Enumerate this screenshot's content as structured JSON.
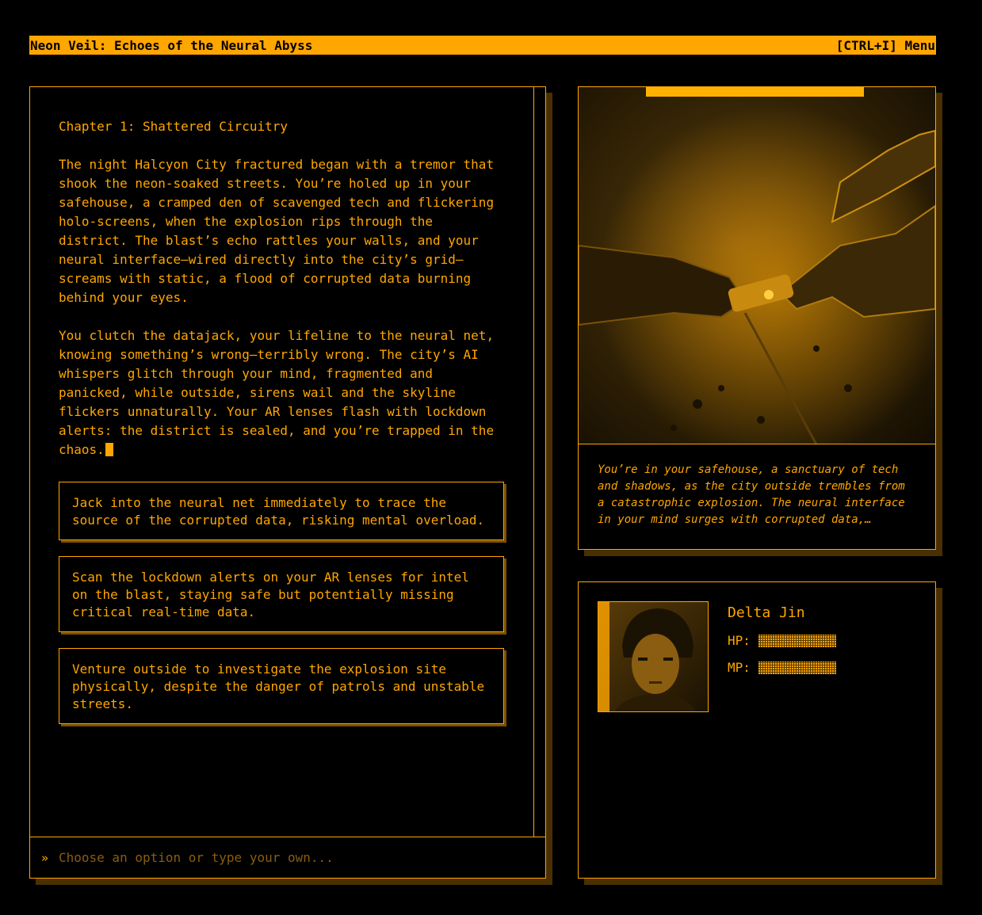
{
  "header": {
    "title": "Neon Veil: Echoes of the Neural Abyss",
    "menu_hint": "[CTRL+I] Menu"
  },
  "story": {
    "chapter": "Chapter 1: Shattered Circuitry",
    "paragraphs": [
      "The night Halcyon City fractured began with a tremor that\nshook the neon-soaked streets. You’re holed up in your\nsafehouse, a cramped den of scavenged tech and flickering\nholo-screens, when the explosion rips through the\ndistrict. The blast’s echo rattles your walls, and your\nneural interface—wired directly into the city’s grid—\nscreams with static, a flood of corrupted data burning\nbehind your eyes.",
      "You clutch the datajack, your lifeline to the neural net,\nknowing something’s wrong—terribly wrong. The city’s AI\nwhispers glitch through your mind, fragmented and\npanicked, while outside, sirens wail and the skyline\nflickers unnaturally. Your AR lenses flash with lockdown\nalerts: the district is sealed, and you’re trapped in the\nchaos."
    ],
    "choices": [
      "Jack into the neural net immediately to trace the source of the corrupted data, risking mental overload.",
      "Scan the lockdown alerts on your AR lenses for intel on the blast, staying safe but potentially missing critical real-time data.",
      "Venture outside to investigate the explosion site physically, despite the danger of patrols and unstable streets."
    ],
    "input_placeholder": "Choose an option or type your own...",
    "prompt_icon": "»"
  },
  "scene": {
    "caption": "You’re in your safehouse, a sanctuary of tech and shadows, as the city outside trembles from a catastrophic explosion. The neural interface in your mind surges with corrupted data,…"
  },
  "character": {
    "name": "Delta Jin",
    "hp_label": "HP:",
    "mp_label": "MP:",
    "hp": 1.0,
    "mp": 1.0
  },
  "colors": {
    "accent": "#ffa600",
    "background": "#000000"
  }
}
